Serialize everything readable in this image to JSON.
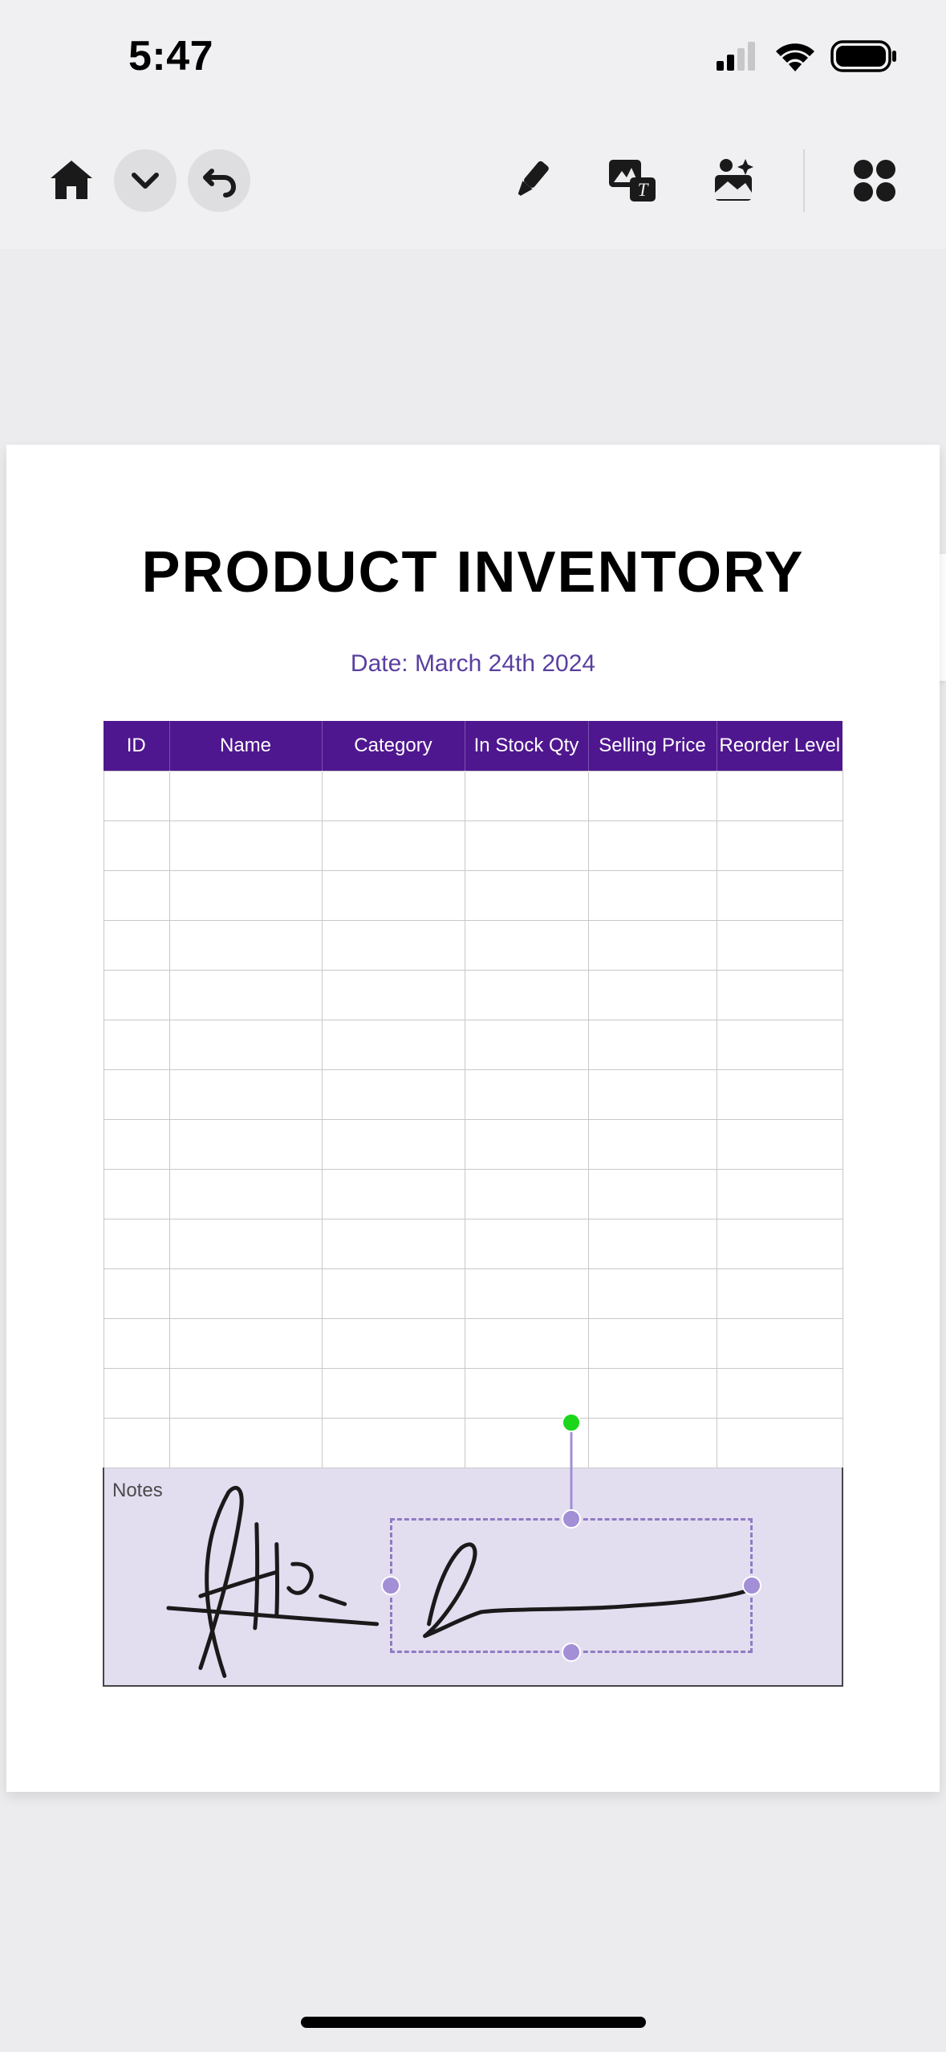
{
  "status": {
    "time": "5:47"
  },
  "toolbar": {
    "home": "home-icon",
    "expand": "chevron-down-icon",
    "undo": "undo-icon",
    "marker": "marker-icon",
    "imagetext": "image-text-icon",
    "magic": "magic-icon",
    "apps": "apps-grid-icon"
  },
  "document": {
    "title": "PRODUCT INVENTORY",
    "date_line": "Date: March 24th 2024",
    "columns": {
      "id": "ID",
      "name": "Name",
      "category": "Category",
      "stock": "In Stock Qty",
      "price": "Selling Price",
      "reorder": "Reorder Level"
    },
    "rows": [
      {
        "id": "",
        "name": "",
        "category": "",
        "stock": "",
        "price": "",
        "reorder": ""
      },
      {
        "id": "",
        "name": "",
        "category": "",
        "stock": "",
        "price": "",
        "reorder": ""
      },
      {
        "id": "",
        "name": "",
        "category": "",
        "stock": "",
        "price": "",
        "reorder": ""
      },
      {
        "id": "",
        "name": "",
        "category": "",
        "stock": "",
        "price": "",
        "reorder": ""
      },
      {
        "id": "",
        "name": "",
        "category": "",
        "stock": "",
        "price": "",
        "reorder": ""
      },
      {
        "id": "",
        "name": "",
        "category": "",
        "stock": "",
        "price": "",
        "reorder": ""
      },
      {
        "id": "",
        "name": "",
        "category": "",
        "stock": "",
        "price": "",
        "reorder": ""
      },
      {
        "id": "",
        "name": "",
        "category": "",
        "stock": "",
        "price": "",
        "reorder": ""
      },
      {
        "id": "",
        "name": "",
        "category": "",
        "stock": "",
        "price": "",
        "reorder": ""
      },
      {
        "id": "",
        "name": "",
        "category": "",
        "stock": "",
        "price": "",
        "reorder": ""
      },
      {
        "id": "",
        "name": "",
        "category": "",
        "stock": "",
        "price": "",
        "reorder": ""
      },
      {
        "id": "",
        "name": "",
        "category": "",
        "stock": "",
        "price": "",
        "reorder": ""
      },
      {
        "id": "",
        "name": "",
        "category": "",
        "stock": "",
        "price": "",
        "reorder": ""
      },
      {
        "id": "",
        "name": "",
        "category": "",
        "stock": "",
        "price": "",
        "reorder": ""
      }
    ],
    "notes_label": "Notes"
  },
  "selection": {
    "present": true,
    "rotate_handle_color": "#1bd61b",
    "handle_color": "#a28fd6"
  }
}
